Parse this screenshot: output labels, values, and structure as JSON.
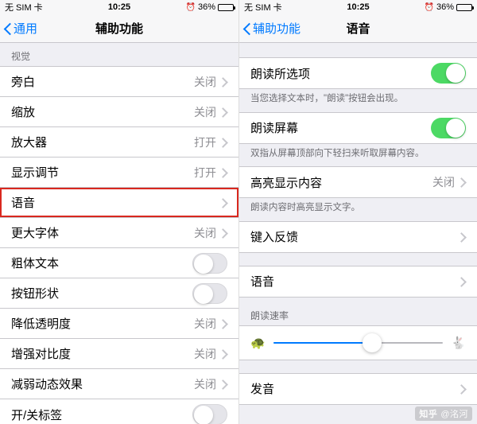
{
  "status": {
    "carrier": "无 SIM 卡",
    "time": "10:25",
    "battery_pct_label": "36%",
    "battery_pct": 36
  },
  "left": {
    "back_label": "通用",
    "title": "辅助功能",
    "section_header": "视觉",
    "rows": [
      {
        "label": "旁白",
        "value": "关闭",
        "kind": "disclosure"
      },
      {
        "label": "缩放",
        "value": "关闭",
        "kind": "disclosure"
      },
      {
        "label": "放大器",
        "value": "打开",
        "kind": "disclosure"
      },
      {
        "label": "显示调节",
        "value": "打开",
        "kind": "disclosure"
      },
      {
        "label": "语音",
        "value": "",
        "kind": "disclosure",
        "highlight": true
      },
      {
        "label": "更大字体",
        "value": "关闭",
        "kind": "disclosure"
      },
      {
        "label": "粗体文本",
        "kind": "switch",
        "on": false
      },
      {
        "label": "按钮形状",
        "kind": "switch",
        "on": false
      },
      {
        "label": "降低透明度",
        "value": "关闭",
        "kind": "disclosure"
      },
      {
        "label": "增强对比度",
        "value": "关闭",
        "kind": "disclosure"
      },
      {
        "label": "减弱动态效果",
        "value": "关闭",
        "kind": "disclosure"
      },
      {
        "label": "开/关标签",
        "kind": "switch",
        "on": false
      }
    ]
  },
  "right": {
    "back_label": "辅助功能",
    "title": "语音",
    "g1": {
      "row_label": "朗读所选项",
      "on": true,
      "footer": "当您选择文本时，\"朗读\"按钮会出现。"
    },
    "g2": {
      "row_label": "朗读屏幕",
      "on": true,
      "footer": "双指从屏幕顶部向下轻扫来听取屏幕内容。"
    },
    "g3": {
      "row_label": "高亮显示内容",
      "value": "关闭",
      "footer": "朗读内容时高亮显示文字。"
    },
    "g4": {
      "row_label": "键入反馈"
    },
    "g5": {
      "row_label": "语音"
    },
    "slider": {
      "header": "朗读速率",
      "value_pct": 58
    },
    "g6": {
      "row_label": "发音"
    }
  },
  "watermark": {
    "brand": "知乎",
    "author": "@洺河"
  }
}
